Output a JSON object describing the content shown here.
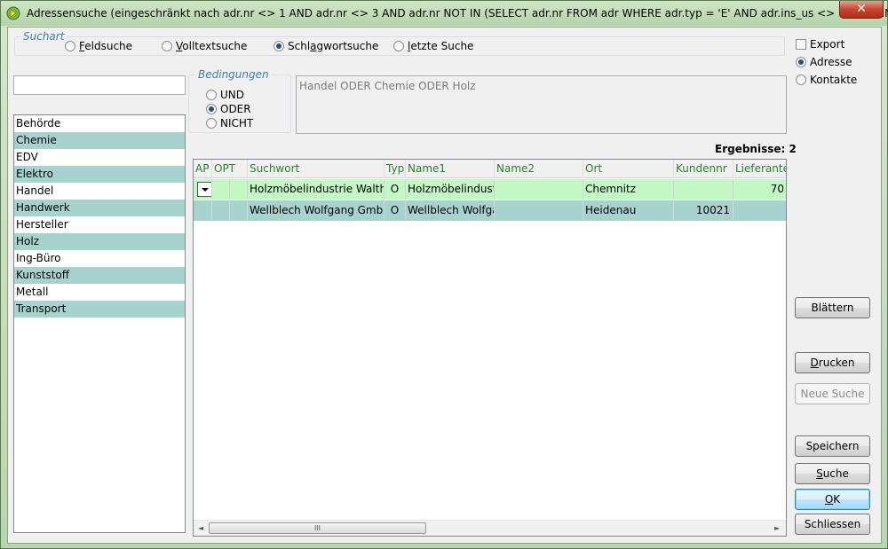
{
  "window": {
    "title": "Adressensuche (eingeschränkt nach  adr.nr <> 1 AND adr.nr <> 3 AND adr.nr NOT IN (SELECT adr.nr FROM adr WHERE adr.typ = 'E' AND adr.ins_us <> 'DBADMIN') )",
    "close_label": "✕"
  },
  "search_type": {
    "title": "Suchart",
    "options": [
      {
        "pre": "",
        "key": "F",
        "post": "eldsuche",
        "selected": false
      },
      {
        "pre": "",
        "key": "V",
        "post": "olltextsuche",
        "selected": false
      },
      {
        "pre": "Schl",
        "key": "a",
        "post": "gwortsuche",
        "selected": true
      },
      {
        "pre": "",
        "key": "l",
        "post": "etzte Suche",
        "selected": false
      }
    ]
  },
  "export": {
    "checkbox_label": "Export",
    "checked": false,
    "options": [
      {
        "label": "Adresse",
        "selected": true
      },
      {
        "label": "Kontakte",
        "selected": false
      }
    ]
  },
  "search_input": {
    "value": ""
  },
  "conditions": {
    "title": "Bedingungen",
    "options": [
      {
        "label": "UND",
        "selected": false
      },
      {
        "label": "ODER",
        "selected": true
      },
      {
        "label": "NICHT",
        "selected": false
      }
    ],
    "expression": "Handel ODER Chemie ODER Holz"
  },
  "keywords": [
    "Behörde",
    "Chemie",
    "EDV",
    "Elektro",
    "Handel",
    "Handwerk",
    "Hersteller",
    "Holz",
    "Ing-Büro",
    "Kunststoff",
    "Metall",
    "Transport"
  ],
  "results": {
    "count_label": "Ergebnisse: 2",
    "columns": [
      "AP",
      "OPT",
      "Suchwort",
      "Typ",
      "Name1",
      "Name2",
      "Ort",
      "Kundennr",
      "Lieferantennr"
    ],
    "rows": [
      {
        "ap": "",
        "opt": "",
        "suchwort": "Holzmöbelindustrie Walther",
        "typ": "O",
        "name1": "Holzmöbelindustrie",
        "name2": "",
        "ort": "Chemnitz",
        "kundennr": "",
        "lieferantennr": "70"
      },
      {
        "ap": "",
        "opt": "",
        "suchwort": "Wellblech Wolfgang GmbH",
        "typ": "O",
        "name1": "Wellblech Wolfgang",
        "name2": "",
        "ort": "Heidenau",
        "kundennr": "10021",
        "lieferantennr": ""
      }
    ],
    "scroll_left": "◄",
    "scroll_right": "►",
    "scroll_grip": "III"
  },
  "buttons": {
    "blaettern": {
      "pre": "Blättern",
      "key": "",
      "post": ""
    },
    "drucken": {
      "pre": "",
      "key": "D",
      "post": "rucken"
    },
    "neue_suche": {
      "pre": "Neue Suche",
      "key": "",
      "post": ""
    },
    "speichern": {
      "pre": "Speichern",
      "key": "",
      "post": ""
    },
    "suche": {
      "pre": "",
      "key": "S",
      "post": "uche"
    },
    "ok": {
      "pre": "",
      "key": "O",
      "post": "K"
    },
    "schliessen": {
      "pre": "Schliessen",
      "key": "",
      "post": ""
    }
  },
  "colors": {
    "row_alt": "#a6d3ce",
    "row_selected": "#c3f7c3",
    "header_text": "#2e7d32",
    "group_title": "#3c7fb1"
  }
}
